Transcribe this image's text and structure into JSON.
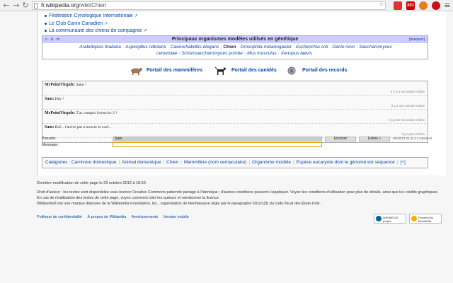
{
  "browser": {
    "url_host": "fr.wikipedia.org",
    "url_path": "/wiki/Chien",
    "extensions": [
      {
        "name": "ext-red-icon",
        "color": "#d33"
      },
      {
        "name": "ext-badge-icon",
        "color": "#c00",
        "badge": "301"
      },
      {
        "name": "ext-orange-icon",
        "color": "#e67e22"
      },
      {
        "name": "opera-icon",
        "color": "#cc0f16"
      }
    ]
  },
  "external_links": [
    "Fédération Cynologique Internationale",
    "Le Club Canin Canadien",
    "La communauté des chiens de compagnie"
  ],
  "navbox": {
    "vde": "v · d · m",
    "title": "Principaux organismes modèles utilisés en génétique",
    "hide": "[masquer]",
    "items": [
      "Arabidopsis thaliana",
      "Aspergillus nidulans",
      "Caenorhabditis elegans",
      "Chien",
      "Drosophila melanogaster",
      "Escherichia coli",
      "Danio rerio",
      "Saccharomyces cerevisiae",
      "Schizosaccharomyces pombe",
      "Mus musculus",
      "Xenopus laevis"
    ]
  },
  "portals": [
    {
      "label": "Portail des mammifères",
      "icon": "mammal-icon"
    },
    {
      "label": "Portail des canidés",
      "icon": "dog-icon"
    },
    {
      "label": "Portail des records",
      "icon": "records-icon"
    }
  ],
  "chat": {
    "messages": [
      {
        "user": "MrPointVirgule:",
        "text": " Salut !",
        "time": "Il y a 5 secondes Online"
      },
      {
        "user": "Sam:",
        "text": " Hey !",
        "time": "Il y a une minute Online"
      },
      {
        "user": "MrPointVirgule:",
        "text": " T'as compris l'exercice 3 ?",
        "time": "Il y a 52 secondes Online"
      },
      {
        "user": "Sam:",
        "text": " Bof... J'arrive pas à trouver la coef...",
        "time": "Il y a peu Online"
      }
    ],
    "pseudo_label": "Pseudo:",
    "pseudo_value": "Sam",
    "message_label": "Message:",
    "send_label": "Envoyer",
    "extras_label": "Extras »",
    "stamp": "30/10/12 21:11 | 1 connecté"
  },
  "categories": {
    "head": "Catégories",
    "items": [
      "Carnivore domestique",
      "Animal domestique",
      "Chien",
      "Mammifère (nom vernaculaire)",
      "Organisme modèle",
      "Espèce eucaryote dont le génome est séquencé"
    ],
    "plus": "[+]"
  },
  "footer": {
    "lastmod": "Dernière modification de cette page le 29 octobre 2012 à 18:52.",
    "license": "Droit d'auteur : les textes sont disponibles sous licence Creative Commons paternité partage à l'identique ; d'autres conditions peuvent s'appliquer. Voyez les conditions d'utilisation pour plus de détails, ainsi que les crédits graphiques.",
    "reuse": "En cas de réutilisation des textes de cette page, voyez comment citer les auteurs et mentionner la licence.",
    "trademark": "Wikipedia® est une marque déposée de la Wikimedia Foundation, Inc., organisation de bienfaisance régie par le paragraphe 501(c)(3) du code fiscal des États-Unis.",
    "links": [
      "Politique de confidentialité",
      "À propos de Wikipédia",
      "Avertissements",
      "Version mobile"
    ],
    "badge_wikimedia": "WIKIMEDIA project",
    "badge_mediawiki": "Powered by MediaWiki"
  }
}
